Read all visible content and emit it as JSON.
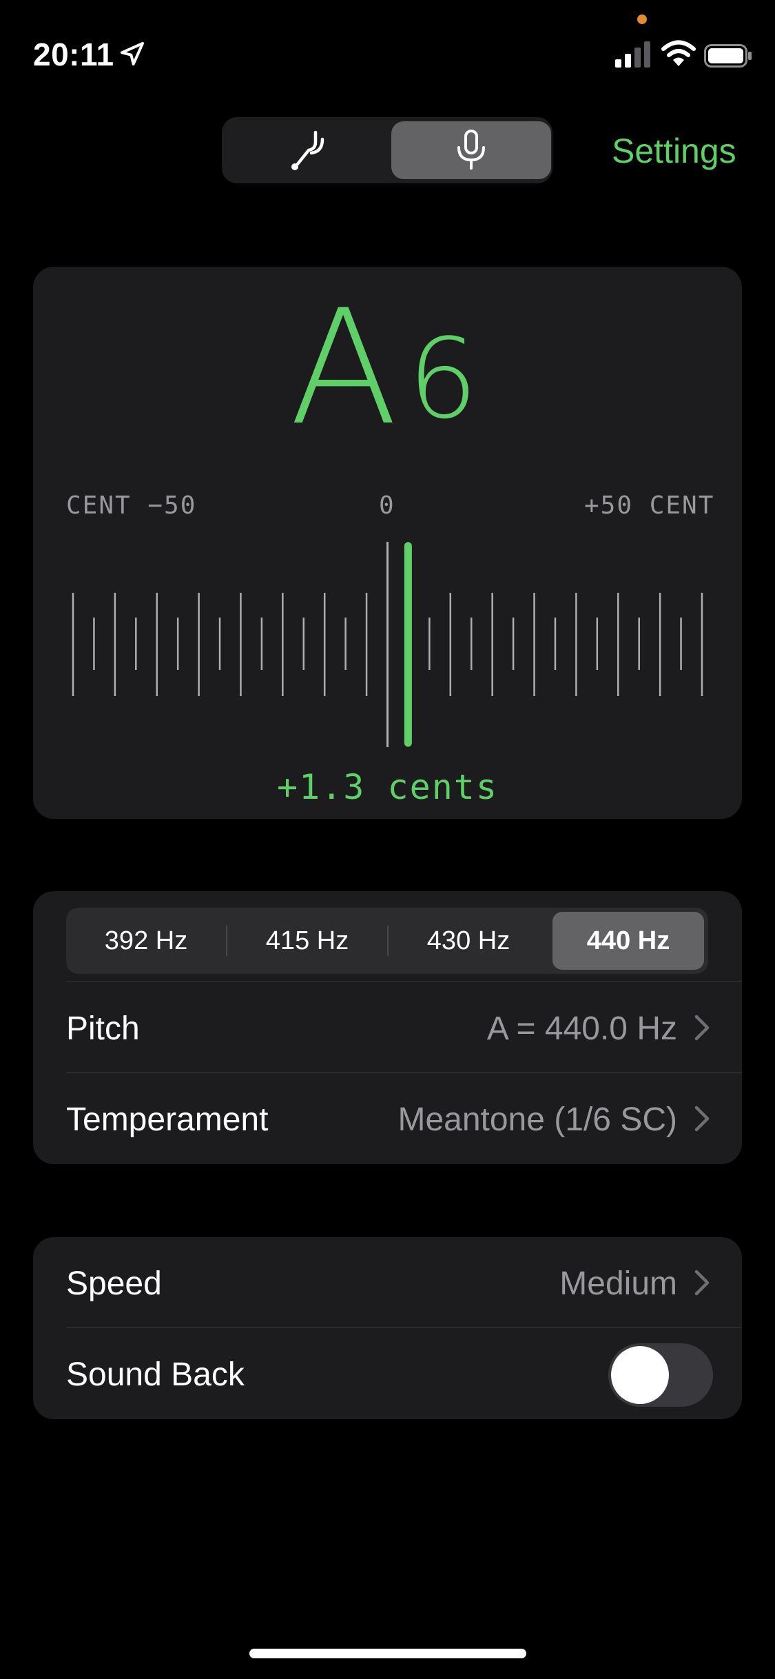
{
  "status_bar": {
    "time": "20:11",
    "icons": [
      "location-arrow-icon",
      "cellular-signal-icon",
      "wifi-icon",
      "battery-icon"
    ]
  },
  "mode_switch": {
    "segments": [
      {
        "icon": "tuning-fork-icon",
        "selected": false
      },
      {
        "icon": "microphone-icon",
        "selected": true
      }
    ]
  },
  "header": {
    "settings_label": "Settings"
  },
  "tuner": {
    "note_letter": "A",
    "note_octave": "6",
    "scale_left": "CENT −50",
    "scale_center": "0",
    "scale_right": "+50 CENT",
    "cents_readout": "+1.3 cents",
    "cents_value": 1.3,
    "cents_range": [
      -50,
      50
    ]
  },
  "reference_frequencies": {
    "options": [
      "392 Hz",
      "415 Hz",
      "430 Hz",
      "440 Hz"
    ],
    "selected_index": 3
  },
  "settings": {
    "pitch": {
      "label": "Pitch",
      "value": "A = 440.0 Hz"
    },
    "temperament": {
      "label": "Temperament",
      "value": "Meantone (1/6 SC)"
    },
    "speed": {
      "label": "Speed",
      "value": "Medium"
    },
    "sound_back": {
      "label": "Sound Back",
      "on": false
    }
  },
  "colors": {
    "accent": "#5fd068",
    "card": "#1c1c1e",
    "secondary_text": "#98989d",
    "background": "#000000"
  }
}
